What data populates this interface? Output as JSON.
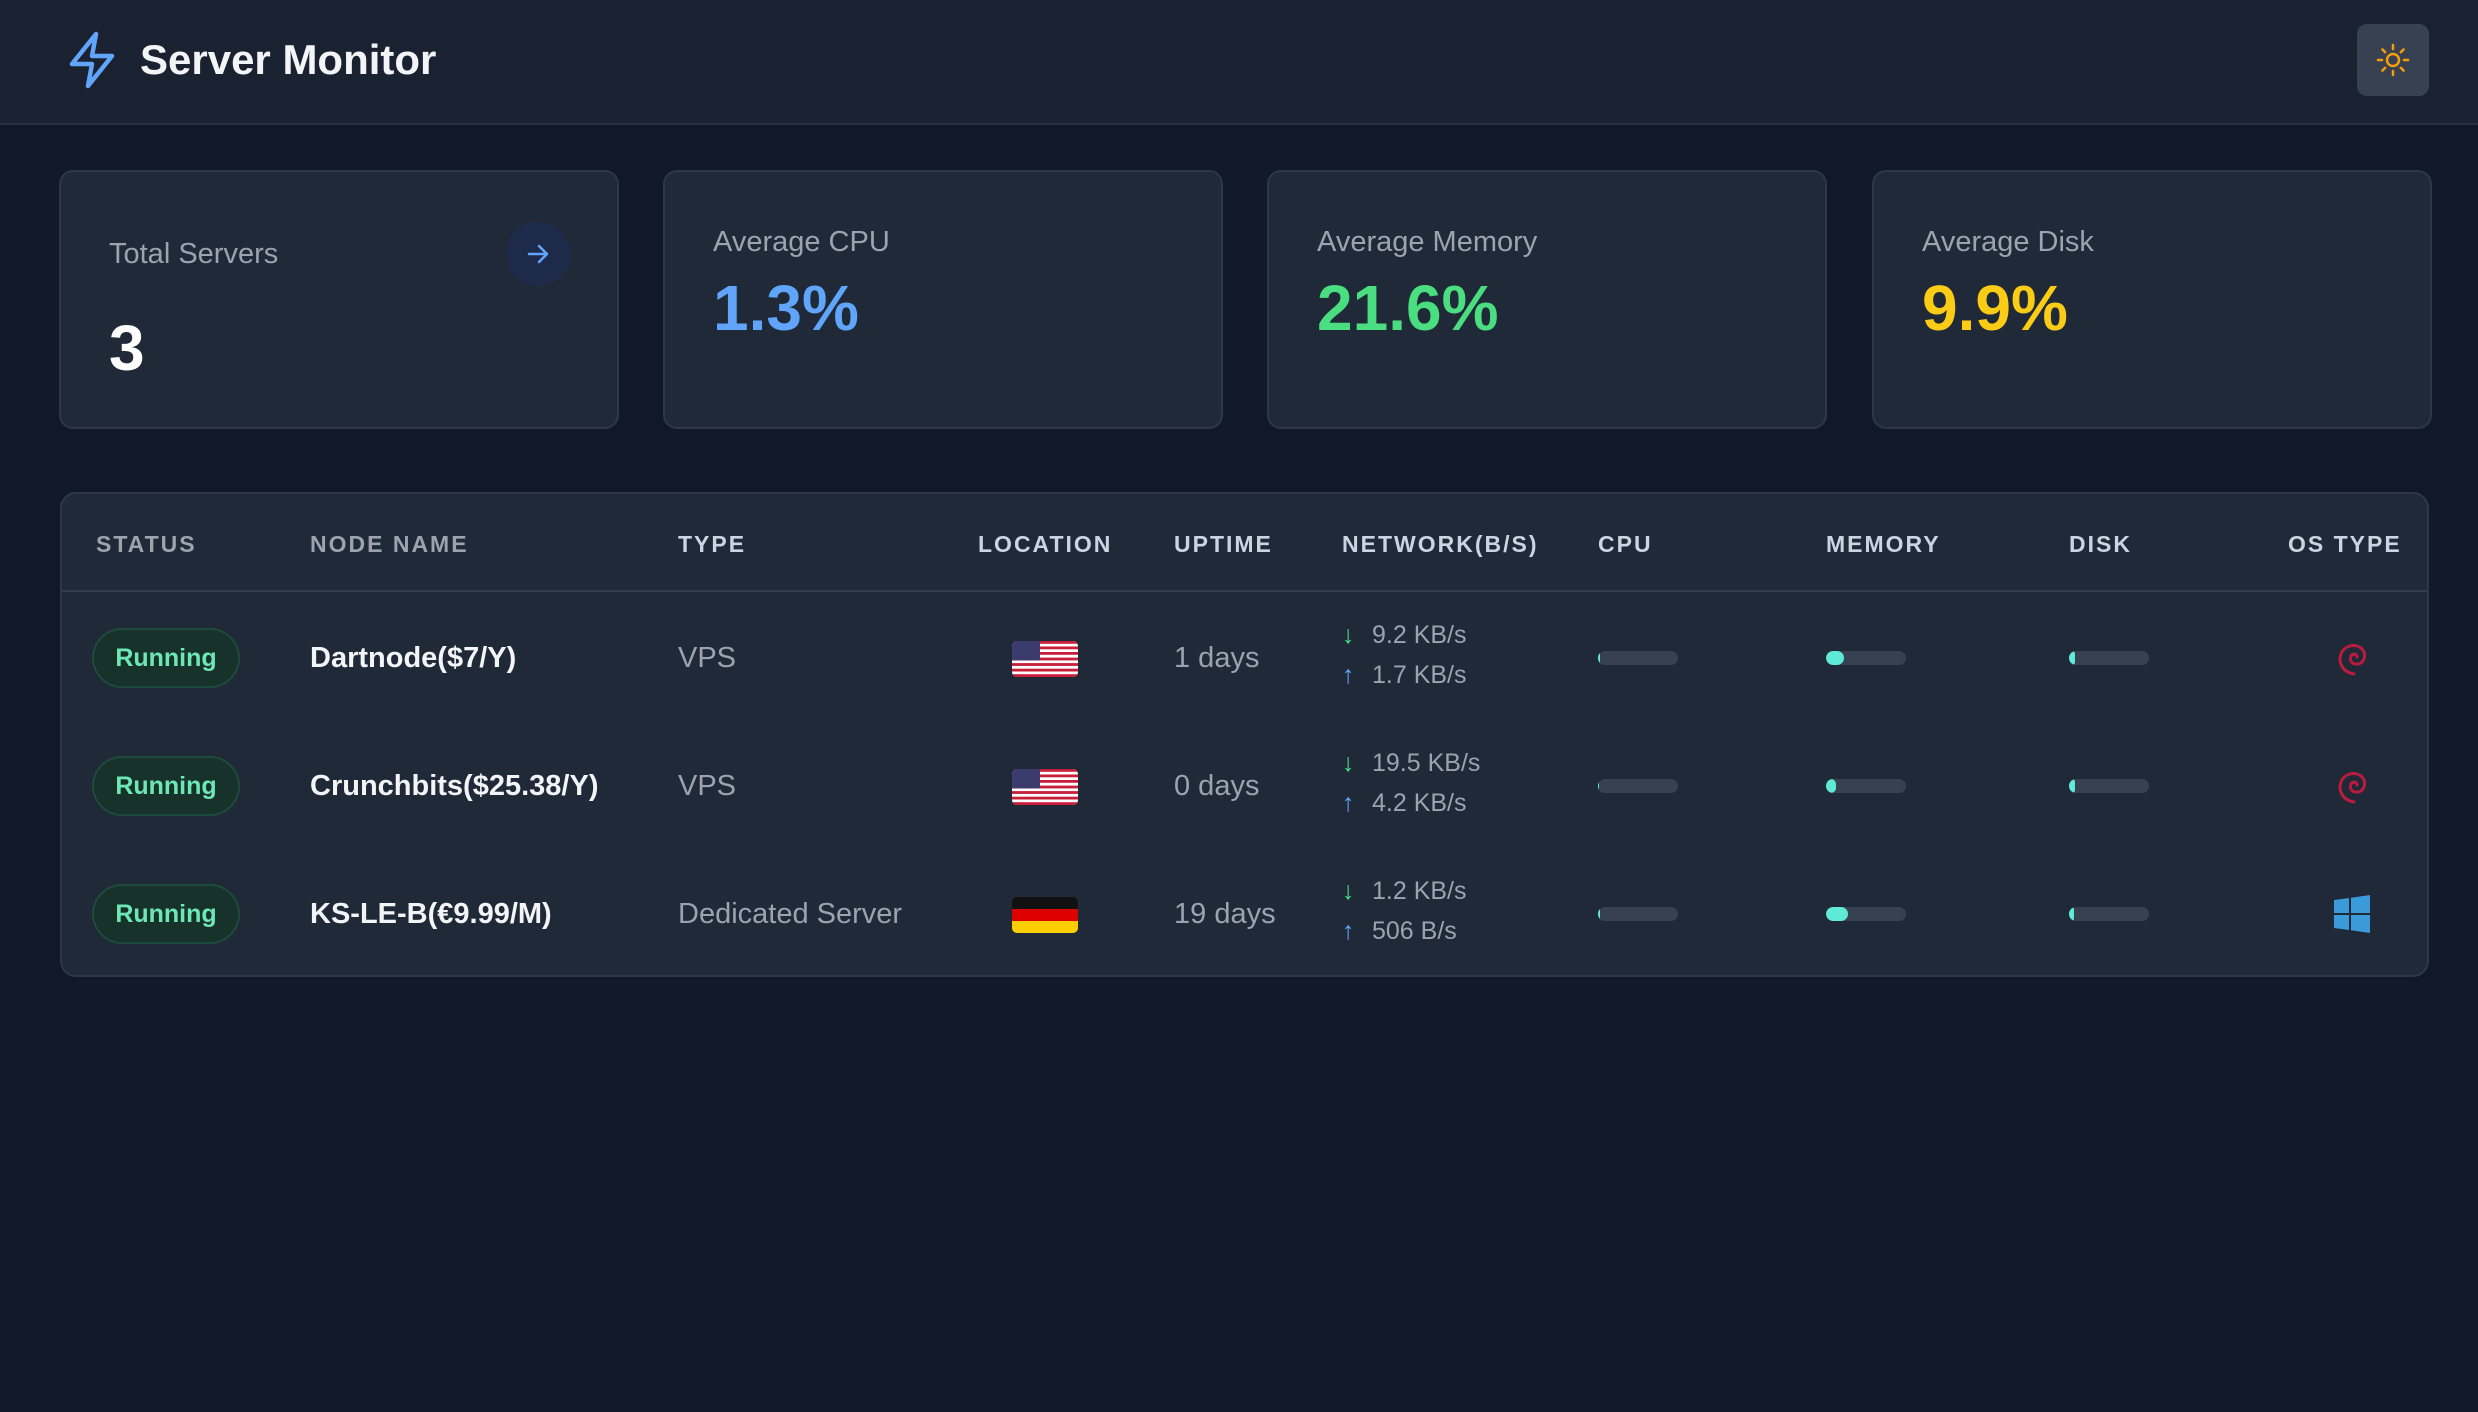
{
  "header": {
    "title": "Server Monitor",
    "logo_icon": "lightning-bolt-icon",
    "theme_icon": "sun-icon"
  },
  "colors": {
    "background": "#111827",
    "card": "#1f2937",
    "accent_blue": "#60a5fa",
    "accent_green": "#4ade80",
    "accent_yellow": "#facc15",
    "status_green": "#6ee7b7"
  },
  "summary": {
    "total": {
      "label": "Total Servers",
      "value": "3",
      "icon": "arrow-right-icon"
    },
    "cpu": {
      "label": "Average CPU",
      "value": "1.3%"
    },
    "memory": {
      "label": "Average Memory",
      "value": "21.6%"
    },
    "disk": {
      "label": "Average Disk",
      "value": "9.9%"
    }
  },
  "table": {
    "columns": [
      "STATUS",
      "NODE NAME",
      "TYPE",
      "LOCATION",
      "UPTIME",
      "NETWORK(B/S)",
      "CPU",
      "MEMORY",
      "DISK",
      "OS TYPE"
    ],
    "rows": [
      {
        "status": "Running",
        "name": "Dartnode($7/Y)",
        "type": "VPS",
        "location": "us-flag-icon",
        "uptime": "1 days",
        "net_down": "9.2 KB/s",
        "net_up": "1.7 KB/s",
        "cpu_fraction": 0.02,
        "memory_fraction": 0.22,
        "disk_fraction": 0.08,
        "os": "debian-icon"
      },
      {
        "status": "Running",
        "name": "Crunchbits($25.38/Y)",
        "type": "VPS",
        "location": "us-flag-icon",
        "uptime": "0 days",
        "net_down": "19.5 KB/s",
        "net_up": "4.2 KB/s",
        "cpu_fraction": 0.01,
        "memory_fraction": 0.12,
        "disk_fraction": 0.08,
        "os": "debian-icon"
      },
      {
        "status": "Running",
        "name": "KS-LE-B(€9.99/M)",
        "type": "Dedicated Server",
        "location": "de-flag-icon",
        "uptime": "19 days",
        "net_down": "1.2 KB/s",
        "net_up": "506 B/s",
        "cpu_fraction": 0.02,
        "memory_fraction": 0.28,
        "disk_fraction": 0.06,
        "os": "windows-icon"
      }
    ]
  }
}
